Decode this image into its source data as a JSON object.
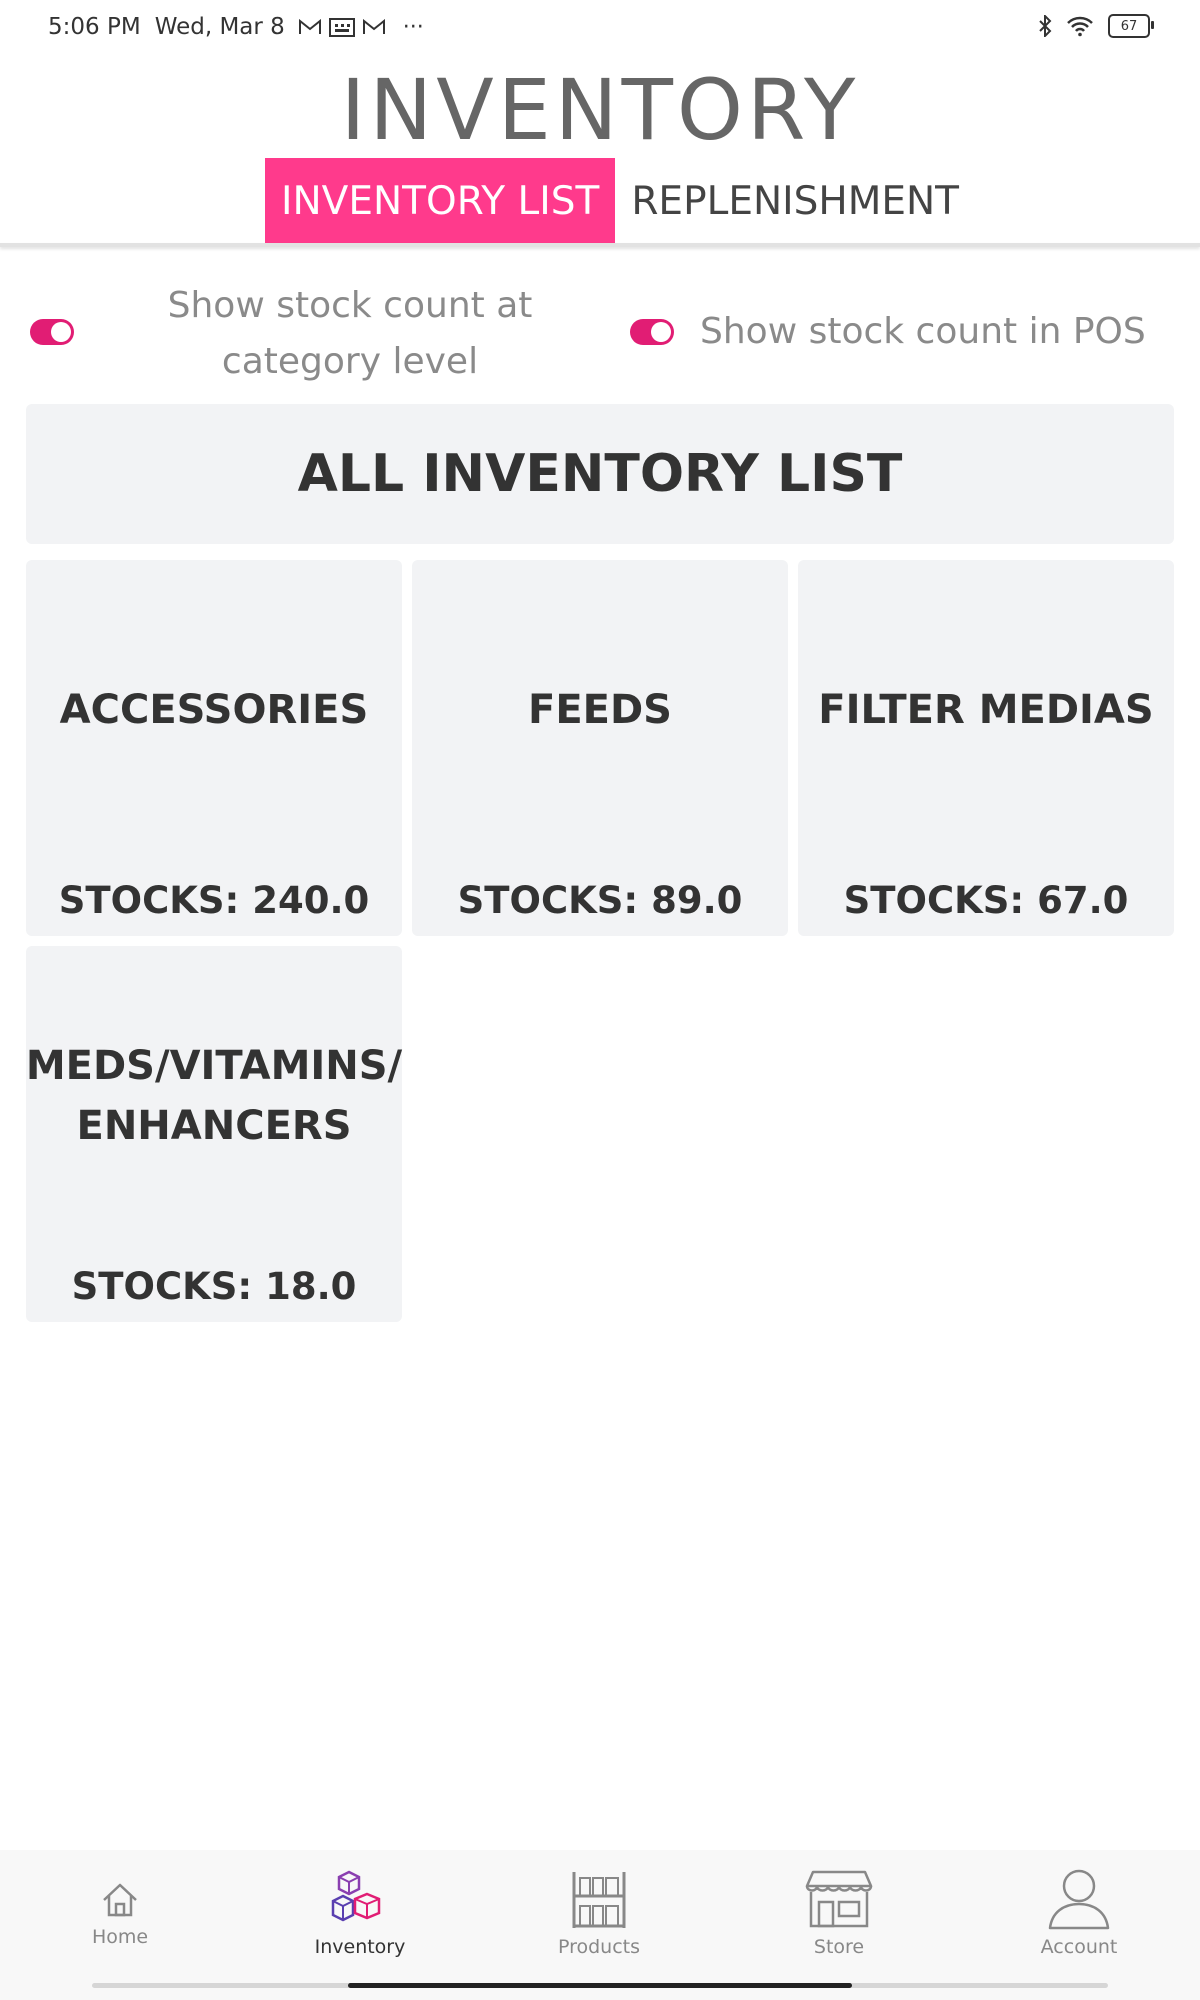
{
  "status_bar": {
    "time": "5:06 PM",
    "date": "Wed, Mar 8",
    "battery": "67",
    "icons": [
      "gmail-icon",
      "calendar-icon",
      "gmail-icon",
      "more-icon",
      "bluetooth-icon",
      "wifi-icon",
      "battery-icon"
    ]
  },
  "header": {
    "title": "INVENTORY",
    "tabs": [
      {
        "label": "INVENTORY LIST",
        "active": true
      },
      {
        "label": "REPLENISHMENT",
        "active": false
      }
    ]
  },
  "toggles": [
    {
      "label_line1": "Show stock count at",
      "label_line2": "category level",
      "on": true
    },
    {
      "label": "Show stock count in POS",
      "on": true
    }
  ],
  "all_inventory": {
    "label": "ALL INVENTORY LIST"
  },
  "categories": [
    {
      "name": "ACCESSORIES",
      "stock": "STOCKS: 240.0"
    },
    {
      "name": "FEEDS",
      "stock": "STOCKS: 89.0"
    },
    {
      "name": "FILTER MEDIAS",
      "stock": "STOCKS: 67.0"
    },
    {
      "name_line1": "MEDS/VITAMINS/",
      "name_line2": "ENHANCERS",
      "stock": "STOCKS: 18.0"
    }
  ],
  "bottom_nav": [
    {
      "label": "Home",
      "icon": "home-icon",
      "active": false
    },
    {
      "label": "Inventory",
      "icon": "inventory-boxes-icon",
      "active": true
    },
    {
      "label": "Products",
      "icon": "shelf-icon",
      "active": false
    },
    {
      "label": "Store",
      "icon": "store-icon",
      "active": false
    },
    {
      "label": "Account",
      "icon": "account-icon",
      "active": false
    }
  ],
  "colors": {
    "accent": "#ff3a8c",
    "toggle_on": "#e11d74",
    "card_bg": "#f2f3f5",
    "title_gray": "#666666"
  }
}
